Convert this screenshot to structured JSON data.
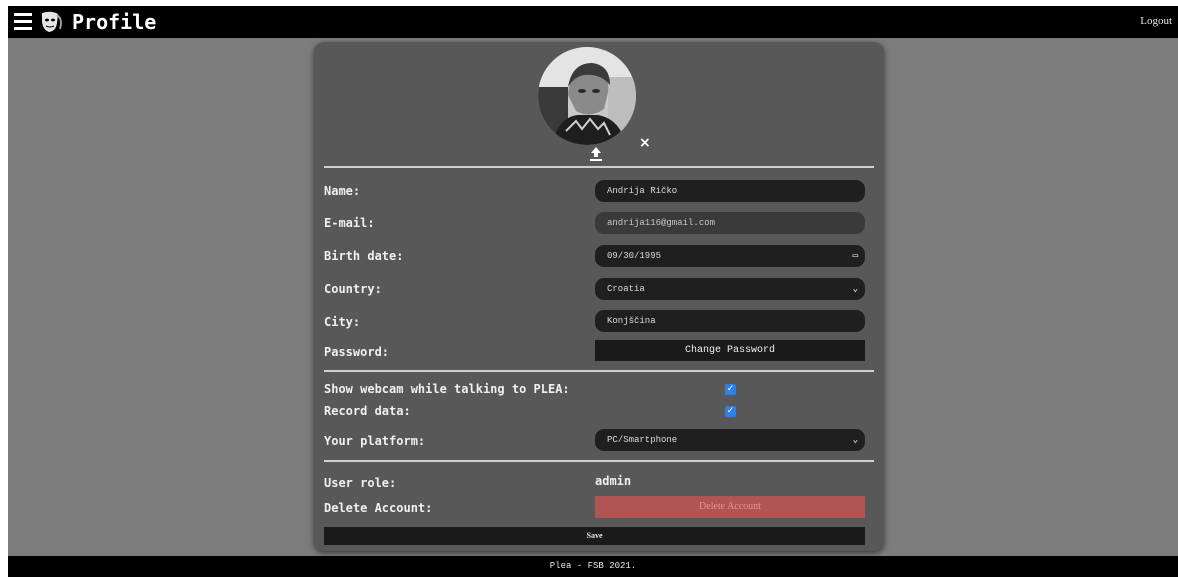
{
  "header": {
    "title": "Profile",
    "menu_icon": "hamburger-icon",
    "logo_icon": "plea-mask-logo",
    "logout_label": "Logout"
  },
  "profile_photo": {
    "upload_icon": "upload-icon",
    "remove_glyph": "×"
  },
  "form": {
    "name": {
      "label": "Name:",
      "value": "Andrija Ričko"
    },
    "email": {
      "label": "E-mail:",
      "value": "andrija116@gmail.com"
    },
    "birth_date": {
      "label": "Birth date:",
      "value": "09/30/1995"
    },
    "country": {
      "label": "Country:",
      "value": "Croatia"
    },
    "city": {
      "label": "City:",
      "value": "Konjščina"
    },
    "password": {
      "label": "Password:",
      "button": "Change Password"
    },
    "show_webcam": {
      "label": "Show webcam while talking to PLEA:",
      "checked": true
    },
    "record_data": {
      "label": "Record data:",
      "checked": true
    },
    "platform": {
      "label": "Your platform:",
      "value": "PC/Smartphone"
    },
    "user_role": {
      "label": "User role:",
      "value": "admin"
    },
    "delete_account": {
      "label": "Delete Account:",
      "button": "Delete Account"
    },
    "save_label": "Save"
  },
  "footer": {
    "text": "Plea - FSB 2021."
  },
  "colors": {
    "topbar": "#000000",
    "background": "#7c7c7c",
    "card": "#585858",
    "field": "#1f1f1f",
    "checkbox": "#2f7fe4",
    "danger": "#b05454"
  }
}
